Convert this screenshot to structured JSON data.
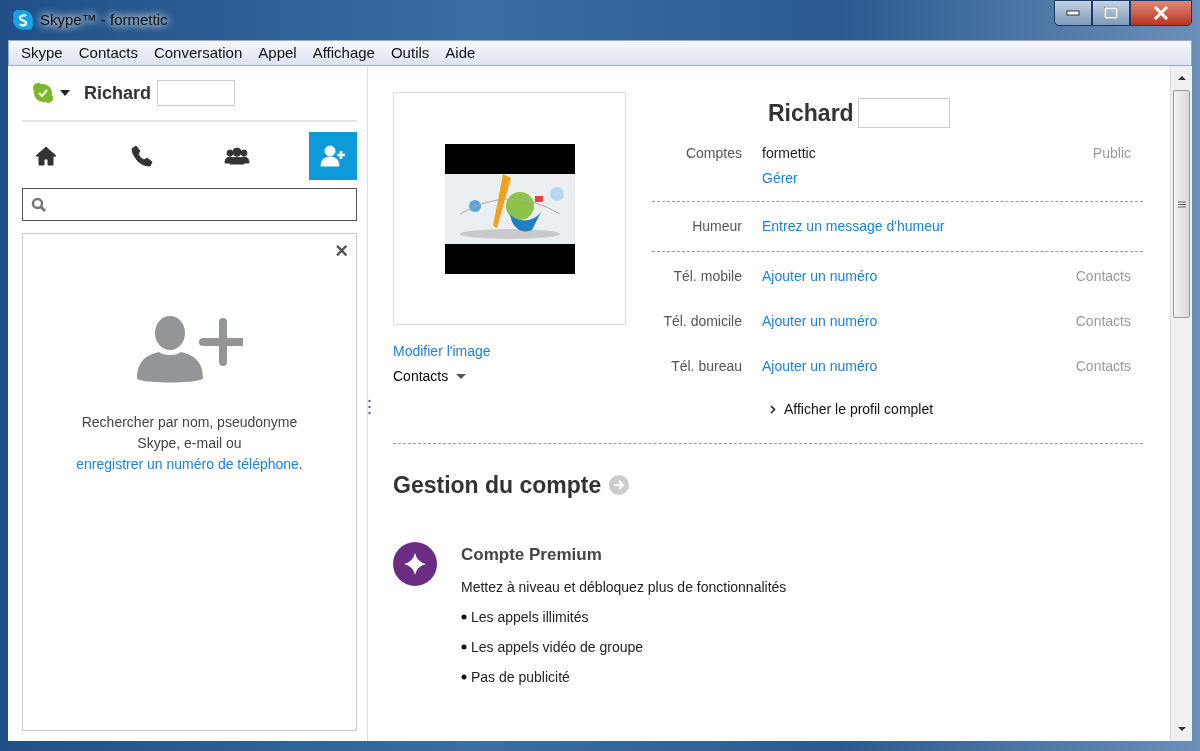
{
  "window": {
    "title": "Skype™ - formettic"
  },
  "menu": [
    {
      "label": "Skype"
    },
    {
      "label": "Contacts"
    },
    {
      "label": "Conversation"
    },
    {
      "label": "Appel"
    },
    {
      "label": "Affichage"
    },
    {
      "label": "Outils"
    },
    {
      "label": "Aide"
    }
  ],
  "sidebar": {
    "user": {
      "name": "Richard",
      "online": true
    },
    "tabs": [
      {
        "kind": "home",
        "selected": false
      },
      {
        "kind": "call",
        "selected": false
      },
      {
        "kind": "contacts",
        "selected": false
      },
      {
        "kind": "add-contact",
        "selected": true
      }
    ],
    "panel": {
      "close": "×",
      "text_before": "Rechercher par nom, pseudonyme Skype, e-mail ou ",
      "link": "enregistrer un numéro de téléphone",
      "text_after": "."
    }
  },
  "profile": {
    "photo": {
      "kind": "picture"
    },
    "change_image": "Modifier l'image",
    "visibility_menu": "Contacts",
    "name": "Richard",
    "groups": [
      [
        {
          "kind": "text",
          "label": "Comptes",
          "value": "formettic",
          "sub_link": "Gérer",
          "visibility": "Public"
        }
      ],
      [
        {
          "kind": "link",
          "label": "Humeur",
          "value": "Entrez un message d'humeur"
        }
      ],
      [
        {
          "kind": "link",
          "label": "Tél. mobile",
          "value": "Ajouter un numéro",
          "visibility": "Contacts"
        },
        {
          "kind": "link",
          "label": "Tél. domicile",
          "value": "Ajouter un numéro",
          "visibility": "Contacts"
        },
        {
          "kind": "link",
          "label": "Tél. bureau",
          "value": "Ajouter un numéro",
          "visibility": "Contacts"
        }
      ]
    ],
    "full_profile": "Afficher le profil complet"
  },
  "account": {
    "title": "Gestion du compte",
    "premium": {
      "title": "Compte Premium",
      "description": "Mettez à niveau et débloquez plus de fonctionnalités",
      "features": [
        "Les appels illimités",
        "Les appels vidéo de groupe",
        "Pas de publicité"
      ]
    }
  }
}
